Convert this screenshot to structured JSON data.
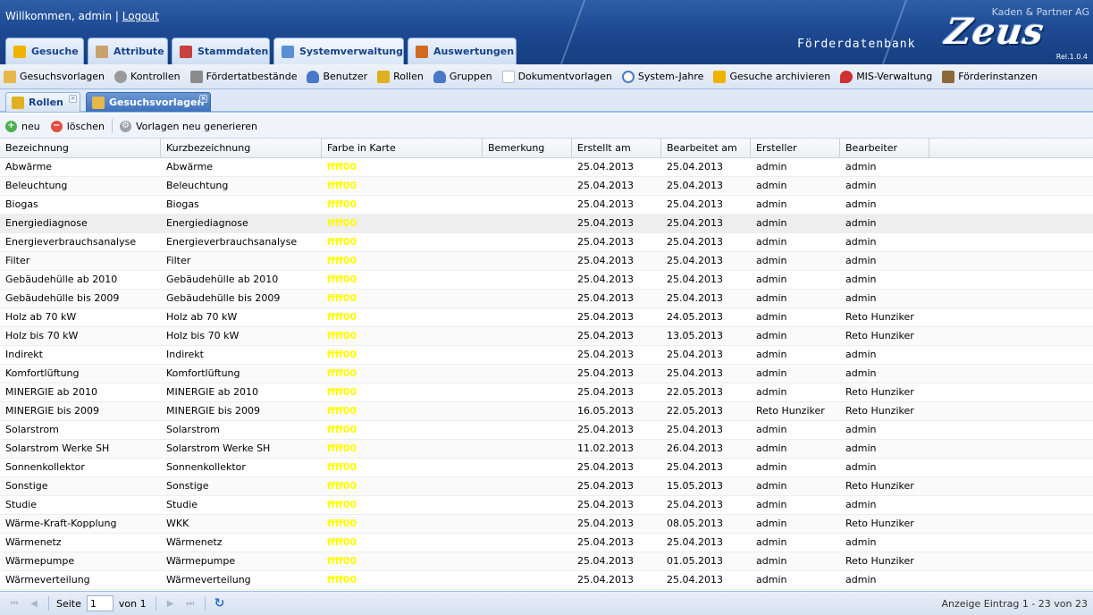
{
  "header": {
    "welcome": "Willkommen, admin |",
    "logout": "Logout",
    "company": "Kaden & Partner AG",
    "app_name": "Förderdatenbank",
    "logo": "Zeus",
    "release": "Rel.1.0.4"
  },
  "main_tabs": [
    {
      "label": "Gesuche",
      "icon": "lightning-icon",
      "color": "#f0b400"
    },
    {
      "label": "Attribute",
      "icon": "tag-icon",
      "color": "#c9a26b"
    },
    {
      "label": "Stammdaten",
      "icon": "database-icon",
      "color": "#c84040"
    },
    {
      "label": "Systemverwaltung",
      "icon": "window-icon",
      "color": "#5a8fd6"
    },
    {
      "label": "Auswertungen",
      "icon": "report-icon",
      "color": "#d2691e"
    }
  ],
  "sub_toolbar": [
    {
      "label": "Gesuchsvorlagen",
      "icon": "folder-icon",
      "color": "#e6b84a"
    },
    {
      "label": "Kontrollen",
      "icon": "control-icon",
      "color": "#9a9a9a"
    },
    {
      "label": "Fördertatbestände",
      "icon": "calculator-icon",
      "color": "#8c8c8c"
    },
    {
      "label": "Benutzer",
      "icon": "user-icon",
      "color": "#4a78c8"
    },
    {
      "label": "Rollen",
      "icon": "key-icon",
      "color": "#e0b020"
    },
    {
      "label": "Gruppen",
      "icon": "group-icon",
      "color": "#4a78c8"
    },
    {
      "label": "Dokumentvorlagen",
      "icon": "document-icon",
      "color": "#bdbdbd"
    },
    {
      "label": "System-Jahre",
      "icon": "clock-icon",
      "color": "#4a78c8"
    },
    {
      "label": "Gesuche archivieren",
      "icon": "lightning-icon",
      "color": "#f0b400"
    },
    {
      "label": "MIS-Verwaltung",
      "icon": "pin-icon",
      "color": "#d03030"
    },
    {
      "label": "Förderinstanzen",
      "icon": "truck-icon",
      "color": "#8a6a3a"
    }
  ],
  "inner_tabs": [
    {
      "label": "Rollen",
      "icon": "key-icon",
      "color": "#e0b020"
    },
    {
      "label": "Gesuchsvorlagen",
      "icon": "folder-icon",
      "color": "#e6b84a"
    }
  ],
  "actions": {
    "new": "neu",
    "delete": "löschen",
    "regenerate": "Vorlagen neu generieren"
  },
  "table": {
    "columns": [
      "Bezeichnung",
      "Kurzbezeichnung",
      "Farbe in Karte",
      "Bemerkung",
      "Erstellt am",
      "Bearbeitet am",
      "Ersteller",
      "Bearbeiter"
    ],
    "rows": [
      [
        "Abwärme",
        "Abwärme",
        "ffff00",
        "",
        "25.04.2013",
        "25.04.2013",
        "admin",
        "admin"
      ],
      [
        "Beleuchtung",
        "Beleuchtung",
        "ffff00",
        "",
        "25.04.2013",
        "25.04.2013",
        "admin",
        "admin"
      ],
      [
        "Biogas",
        "Biogas",
        "ffff00",
        "",
        "25.04.2013",
        "25.04.2013",
        "admin",
        "admin"
      ],
      [
        "Energiediagnose",
        "Energiediagnose",
        "ffff00",
        "",
        "25.04.2013",
        "25.04.2013",
        "admin",
        "admin"
      ],
      [
        "Energieverbrauchsanalyse",
        "Energieverbrauchsanalyse",
        "ffff00",
        "",
        "25.04.2013",
        "25.04.2013",
        "admin",
        "admin"
      ],
      [
        "Filter",
        "Filter",
        "ffff00",
        "",
        "25.04.2013",
        "25.04.2013",
        "admin",
        "admin"
      ],
      [
        "Gebäudehülle ab 2010",
        "Gebäudehülle ab 2010",
        "ffff00",
        "",
        "25.04.2013",
        "25.04.2013",
        "admin",
        "admin"
      ],
      [
        "Gebäudehülle bis 2009",
        "Gebäudehülle bis 2009",
        "ffff00",
        "",
        "25.04.2013",
        "25.04.2013",
        "admin",
        "admin"
      ],
      [
        "Holz ab 70 kW",
        "Holz ab 70 kW",
        "ffff00",
        "",
        "25.04.2013",
        "24.05.2013",
        "admin",
        "Reto Hunziker"
      ],
      [
        "Holz bis 70 kW",
        "Holz bis 70 kW",
        "ffff00",
        "",
        "25.04.2013",
        "13.05.2013",
        "admin",
        "Reto Hunziker"
      ],
      [
        "Indirekt",
        "Indirekt",
        "ffff00",
        "",
        "25.04.2013",
        "25.04.2013",
        "admin",
        "admin"
      ],
      [
        "Komfortlüftung",
        "Komfortlüftung",
        "ffff00",
        "",
        "25.04.2013",
        "25.04.2013",
        "admin",
        "admin"
      ],
      [
        "MINERGIE ab 2010",
        "MINERGIE ab 2010",
        "ffff00",
        "",
        "25.04.2013",
        "22.05.2013",
        "admin",
        "Reto Hunziker"
      ],
      [
        "MINERGIE bis 2009",
        "MINERGIE bis 2009",
        "ffff00",
        "",
        "16.05.2013",
        "22.05.2013",
        "Reto Hunziker",
        "Reto Hunziker"
      ],
      [
        "Solarstrom",
        "Solarstrom",
        "ffff00",
        "",
        "25.04.2013",
        "25.04.2013",
        "admin",
        "admin"
      ],
      [
        "Solarstrom Werke SH",
        "Solarstrom Werke SH",
        "ffff00",
        "",
        "11.02.2013",
        "26.04.2013",
        "admin",
        "admin"
      ],
      [
        "Sonnenkollektor",
        "Sonnenkollektor",
        "ffff00",
        "",
        "25.04.2013",
        "25.04.2013",
        "admin",
        "admin"
      ],
      [
        "Sonstige",
        "Sonstige",
        "ffff00",
        "",
        "25.04.2013",
        "15.05.2013",
        "admin",
        "Reto Hunziker"
      ],
      [
        "Studie",
        "Studie",
        "ffff00",
        "",
        "25.04.2013",
        "25.04.2013",
        "admin",
        "admin"
      ],
      [
        "Wärme-Kraft-Kopplung",
        "WKK",
        "ffff00",
        "",
        "25.04.2013",
        "08.05.2013",
        "admin",
        "Reto Hunziker"
      ],
      [
        "Wärmenetz",
        "Wärmenetz",
        "ffff00",
        "",
        "25.04.2013",
        "25.04.2013",
        "admin",
        "admin"
      ],
      [
        "Wärmepumpe",
        "Wärmepumpe",
        "ffff00",
        "",
        "25.04.2013",
        "01.05.2013",
        "admin",
        "Reto Hunziker"
      ],
      [
        "Wärmeverteilung",
        "Wärmeverteilung",
        "ffff00",
        "",
        "25.04.2013",
        "25.04.2013",
        "admin",
        "admin"
      ]
    ]
  },
  "paging": {
    "page_label": "Seite",
    "current_page": "1",
    "of_label": "von 1",
    "display": "Anzeige Eintrag 1 - 23 von 23"
  },
  "colors": {
    "header_bg": "#1d4a93",
    "accent": "#15428b",
    "map_color": "#ffff00"
  }
}
